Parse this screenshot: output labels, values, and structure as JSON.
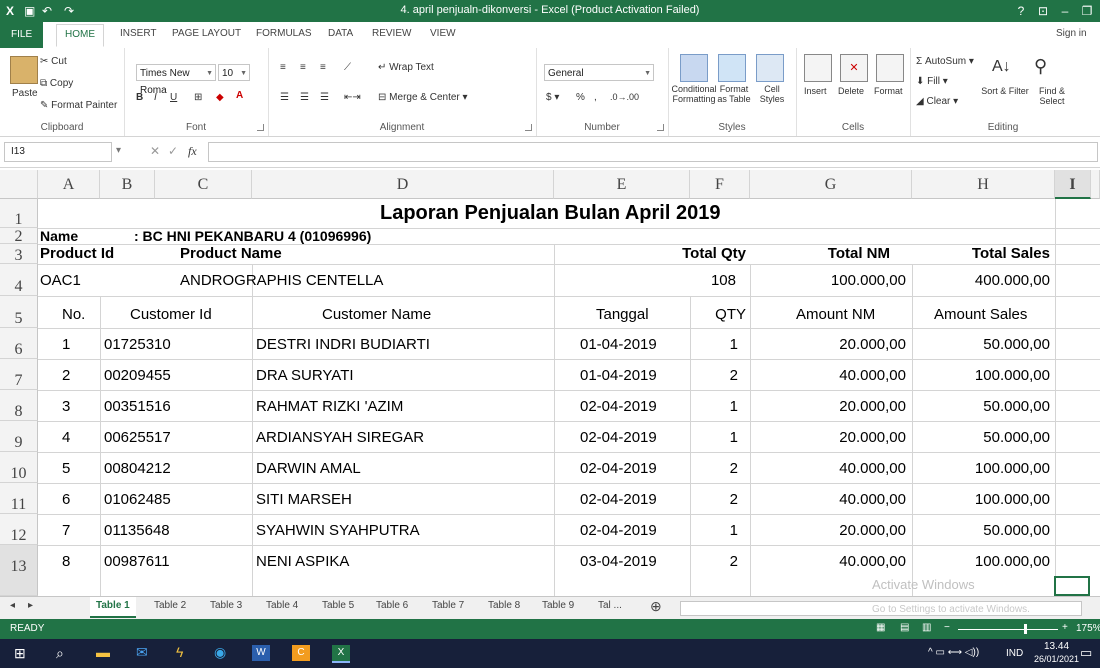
{
  "window": {
    "title": "4. april penjualn-dikonversi - Excel (Product Activation Failed)",
    "help": "?",
    "sign_in": "Sign in"
  },
  "ribbon_tabs": [
    "FILE",
    "HOME",
    "INSERT",
    "PAGE LAYOUT",
    "FORMULAS",
    "DATA",
    "REVIEW",
    "VIEW"
  ],
  "ribbon": {
    "clipboard": {
      "paste": "Paste",
      "cut": "Cut",
      "copy": "Copy",
      "format_painter": "Format Painter",
      "label": "Clipboard"
    },
    "font": {
      "name": "Times New Roma",
      "size": "10",
      "label": "Font",
      "bold": "B",
      "italic": "I",
      "underline": "U"
    },
    "alignment": {
      "wrap": "Wrap Text",
      "merge": "Merge & Center",
      "label": "Alignment"
    },
    "number": {
      "format": "General",
      "percent": "%",
      "comma": ",",
      "label": "Number"
    },
    "styles": {
      "conditional": "Conditional Formatting",
      "format_table": "Format as Table",
      "cell_styles": "Cell Styles",
      "label": "Styles"
    },
    "cells": {
      "insert": "Insert",
      "delete": "Delete",
      "format": "Format",
      "label": "Cells"
    },
    "editing": {
      "autosum": "AutoSum",
      "fill": "Fill",
      "clear": "Clear",
      "sort": "Sort & Filter",
      "find": "Find & Select",
      "label": "Editing"
    }
  },
  "formula_bar": {
    "name_box": "I13",
    "fx": "fx",
    "content": ""
  },
  "columns": [
    "A",
    "B",
    "C",
    "D",
    "E",
    "F",
    "G",
    "H",
    "I"
  ],
  "rows": [
    "1",
    "2",
    "3",
    "4",
    "5",
    "6",
    "7",
    "8",
    "9",
    "10",
    "11",
    "12",
    "13"
  ],
  "sheet": {
    "title": "Laporan Penjualan Bulan April 2019",
    "name_label": "Name",
    "name_value": ": BC HNI PEKANBARU 4 (01096996)",
    "headers1": {
      "product_id": "Product Id",
      "product_name": "Product Name",
      "total_qty": "Total Qty",
      "total_nm": "Total NM",
      "total_sales": "Total Sales"
    },
    "product": {
      "id": "OAC1",
      "name": "ANDROGRAPHIS CENTELLA",
      "total_qty": "108",
      "total_nm": "100.000,00",
      "total_sales": "400.000,00"
    },
    "headers2": {
      "no": "No.",
      "customer_id": "Customer Id",
      "customer_name": "Customer Name",
      "tanggal": "Tanggal",
      "qty": "QTY",
      "amount_nm": "Amount NM",
      "amount_sales": "Amount Sales"
    },
    "data_rows": [
      {
        "no": "1",
        "cid": "01725310",
        "name": "DESTRI INDRI BUDIARTI",
        "date": "01-04-2019",
        "qty": "1",
        "nm": "20.000,00",
        "sales": "50.000,00"
      },
      {
        "no": "2",
        "cid": "00209455",
        "name": "DRA SURYATI",
        "date": "01-04-2019",
        "qty": "2",
        "nm": "40.000,00",
        "sales": "100.000,00"
      },
      {
        "no": "3",
        "cid": "00351516",
        "name": "RAHMAT RIZKI 'AZIM",
        "date": "02-04-2019",
        "qty": "1",
        "nm": "20.000,00",
        "sales": "50.000,00"
      },
      {
        "no": "4",
        "cid": "00625517",
        "name": "ARDIANSYAH SIREGAR",
        "date": "02-04-2019",
        "qty": "1",
        "nm": "20.000,00",
        "sales": "50.000,00"
      },
      {
        "no": "5",
        "cid": "00804212",
        "name": "DARWIN AMAL",
        "date": "02-04-2019",
        "qty": "2",
        "nm": "40.000,00",
        "sales": "100.000,00"
      },
      {
        "no": "6",
        "cid": "01062485",
        "name": "SITI MARSEH",
        "date": "02-04-2019",
        "qty": "2",
        "nm": "40.000,00",
        "sales": "100.000,00"
      },
      {
        "no": "7",
        "cid": "01135648",
        "name": "SYAHWIN SYAHPUTRA",
        "date": "02-04-2019",
        "qty": "1",
        "nm": "20.000,00",
        "sales": "50.000,00"
      },
      {
        "no": "8",
        "cid": "00987611",
        "name": "NENI ASPIKA",
        "date": "03-04-2019",
        "qty": "2",
        "nm": "40.000,00",
        "sales": "100.000,00"
      }
    ]
  },
  "sheet_tabs": [
    "Table 1",
    "Table 2",
    "Table 3",
    "Table 4",
    "Table 5",
    "Table 6",
    "Table 7",
    "Table 8",
    "Table 9",
    "Tal ..."
  ],
  "activate": {
    "line1": "Activate Windows",
    "line2": "Go to Settings to activate Windows."
  },
  "status": {
    "ready": "READY",
    "zoom": "175%"
  },
  "taskbar": {
    "lang": "IND",
    "time": "13.44",
    "date": "26/01/2021"
  },
  "colors": {
    "excel_green": "#217346",
    "taskbar": "#17203a"
  }
}
